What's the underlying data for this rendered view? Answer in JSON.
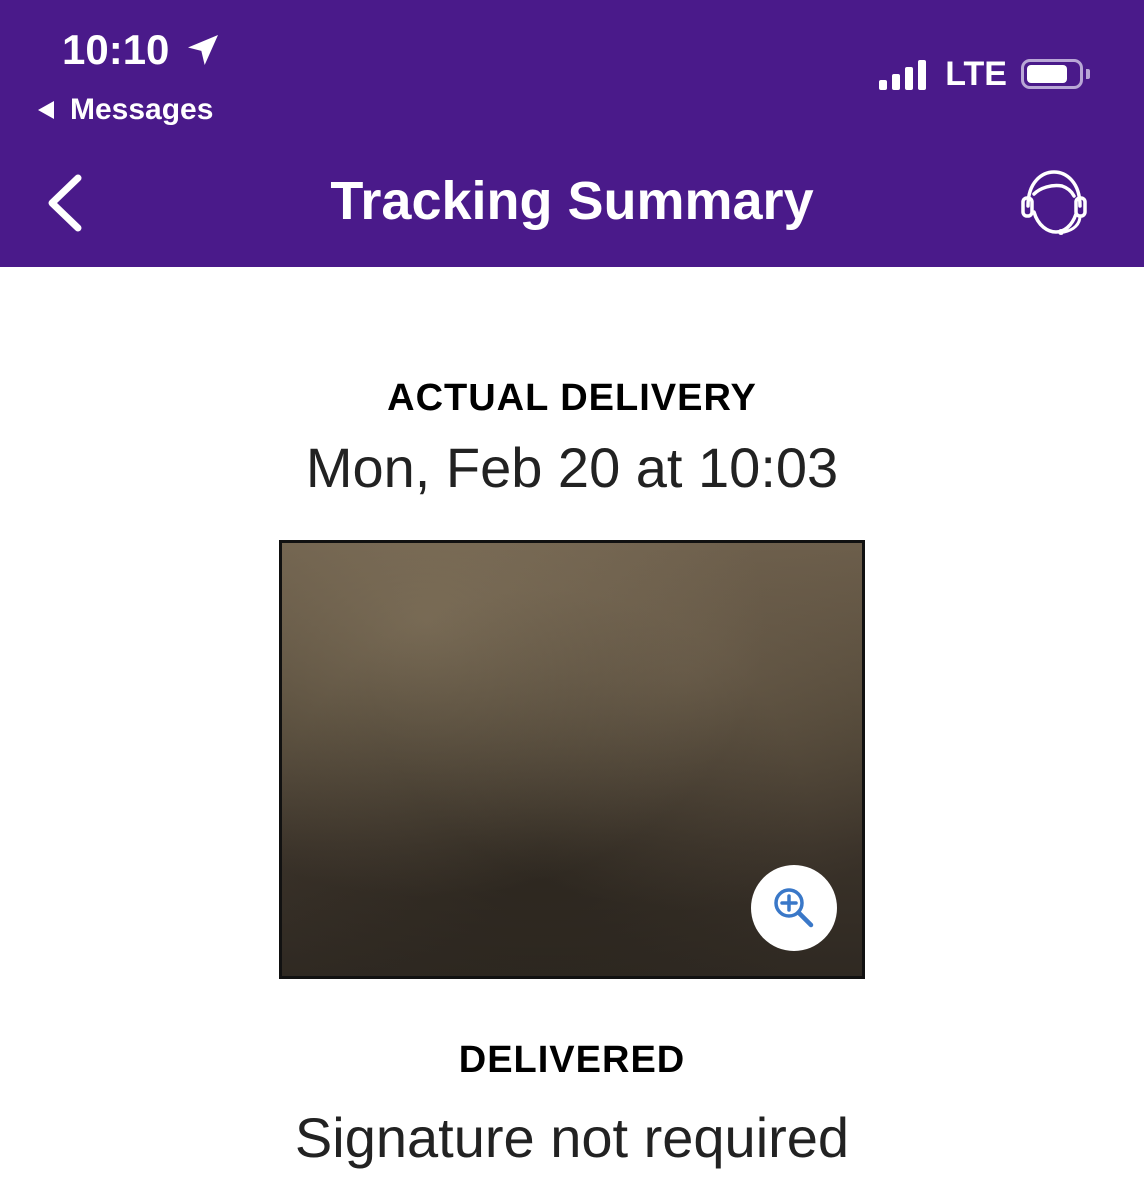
{
  "status_bar": {
    "time": "10:10",
    "back_app": "Messages",
    "network": "LTE"
  },
  "nav": {
    "title": "Tracking Summary"
  },
  "delivery": {
    "label": "ACTUAL DELIVERY",
    "date": "Mon, Feb 20 at 10:03"
  },
  "status": {
    "label": "DELIVERED",
    "detail": "Signature not required"
  },
  "colors": {
    "header_bg": "#4a1a8a",
    "zoom_icon": "#3a78c8"
  },
  "icons": {
    "location": "location-arrow-icon",
    "back": "chevron-left-icon",
    "support": "customer-support-headset-icon",
    "zoom": "zoom-in-icon"
  }
}
